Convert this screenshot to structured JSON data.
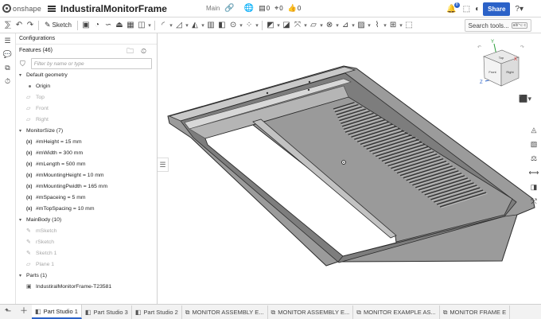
{
  "app": {
    "name": "onshape"
  },
  "document": {
    "title": "IndustiralMonitorFrame",
    "branch": "Main"
  },
  "top_counts": {
    "likes": "0",
    "versions": "0",
    "thumbs": "0"
  },
  "notifications": {
    "count": "8"
  },
  "share_label": "Share",
  "toolbar": {
    "sketch_label": "Sketch",
    "search_label": "Search tools...",
    "search_shortcut": "alt/⌥ c"
  },
  "panel": {
    "configurations": "Configurations",
    "features_header": "Features (46)",
    "filter_placeholder": "Filter by name or type",
    "tree": [
      {
        "kind": "group",
        "label": "Default geometry"
      },
      {
        "kind": "leaf",
        "icon": "dot",
        "label": "Origin",
        "dim": false
      },
      {
        "kind": "leaf",
        "icon": "plane",
        "label": "Top",
        "dim": true
      },
      {
        "kind": "leaf",
        "icon": "plane",
        "label": "Front",
        "dim": true
      },
      {
        "kind": "leaf",
        "icon": "plane",
        "label": "Right",
        "dim": true
      },
      {
        "kind": "group",
        "label": "MonitorSize (7)"
      },
      {
        "kind": "leaf",
        "icon": "var",
        "label": "#mHeight = 15 mm",
        "dim": false
      },
      {
        "kind": "leaf",
        "icon": "var",
        "label": "#mWidth = 300 mm",
        "dim": false
      },
      {
        "kind": "leaf",
        "icon": "var",
        "label": "#mLength = 500 mm",
        "dim": false
      },
      {
        "kind": "leaf",
        "icon": "var",
        "label": "#mMountingHeight = 10 mm",
        "dim": false
      },
      {
        "kind": "leaf",
        "icon": "var",
        "label": "#mMountingPwidth = 165 mm",
        "dim": false
      },
      {
        "kind": "leaf",
        "icon": "var",
        "label": "#mSpaceing = 5 mm",
        "dim": false
      },
      {
        "kind": "leaf",
        "icon": "var",
        "label": "#mTopSpacing = 10 mm",
        "dim": false
      },
      {
        "kind": "group",
        "label": "MainBody (10)"
      },
      {
        "kind": "leaf",
        "icon": "sketch",
        "label": "mSketch",
        "dim": true
      },
      {
        "kind": "leaf",
        "icon": "sketch",
        "label": "rSketch",
        "dim": true
      },
      {
        "kind": "leaf",
        "icon": "sketch",
        "label": "Sketch 1",
        "dim": true
      },
      {
        "kind": "leaf",
        "icon": "plane",
        "label": "Plane 1",
        "dim": true
      },
      {
        "kind": "group",
        "label": "Parts (1)"
      },
      {
        "kind": "leaf",
        "icon": "part",
        "label": "IndustiralMonitorFrame-T23581",
        "dim": false
      }
    ]
  },
  "view_cube": {
    "top": "Top",
    "front": "Front",
    "right": "Right",
    "axis_x": "X",
    "axis_y": "Y",
    "axis_z": "Z"
  },
  "tabs": [
    {
      "label": "Part Studio 1",
      "active": true
    },
    {
      "label": "Part Studio 3",
      "active": false
    },
    {
      "label": "Part Studio 2",
      "active": false
    },
    {
      "label": "MONITOR ASSEMBLY E...",
      "active": false
    },
    {
      "label": "MONITOR ASSEMBLY E...",
      "active": false
    },
    {
      "label": "MONITOR EXAMPLE AS...",
      "active": false
    },
    {
      "label": "MONITOR FRAME E",
      "active": false
    }
  ],
  "colors": {
    "accent": "#2b62c8",
    "model_fill": "#8a8a8a",
    "model_edge": "#2b2b2b"
  },
  "icons": {
    "menu": "hamburger-icon",
    "link": "link-icon",
    "globe": "globe-icon",
    "undo": "undo-icon",
    "redo": "redo-icon",
    "help": "help-icon"
  }
}
